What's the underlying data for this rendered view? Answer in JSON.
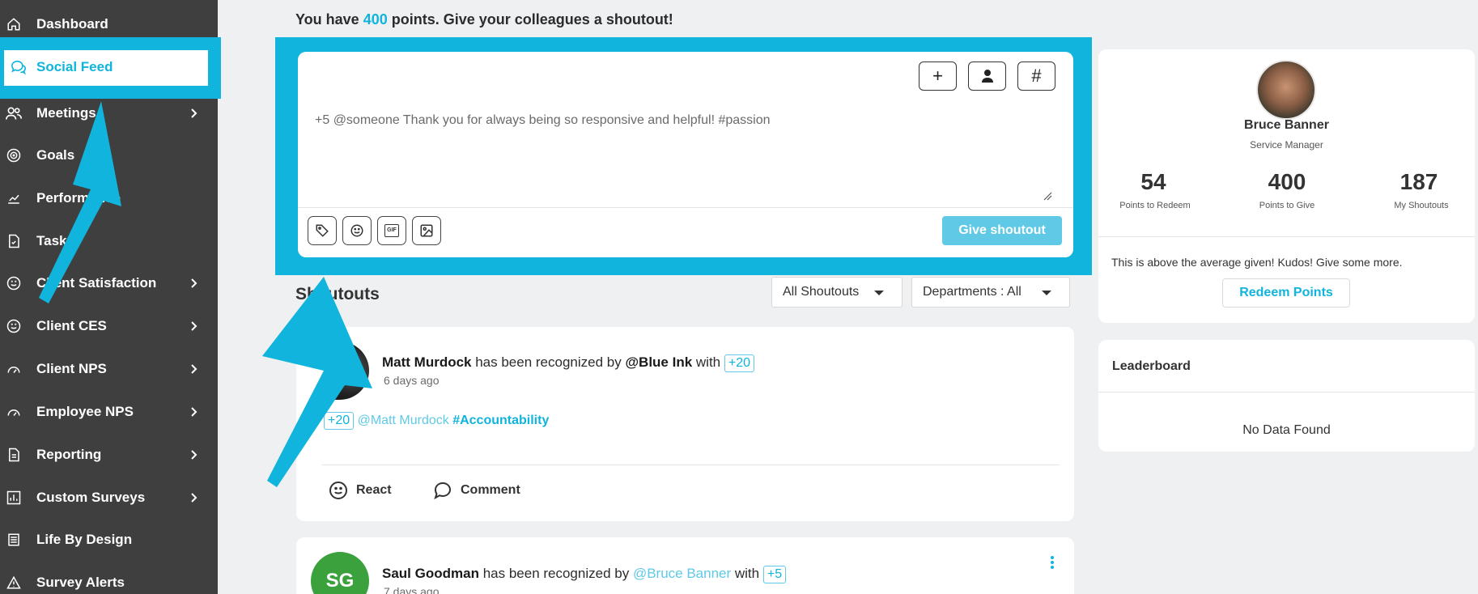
{
  "sidebar": {
    "items": [
      {
        "label": "Dashboard",
        "icon": "home-icon",
        "chevron": false
      },
      {
        "label": "Social Feed",
        "icon": "chat-icon",
        "chevron": false,
        "active": true
      },
      {
        "label": "Meetings",
        "icon": "people-icon",
        "chevron": true
      },
      {
        "label": "Goals",
        "icon": "target-icon",
        "chevron": false
      },
      {
        "label": "Performance",
        "icon": "chart-icon",
        "chevron": false
      },
      {
        "label": "Tasks",
        "icon": "task-icon",
        "chevron": false
      },
      {
        "label": "Client Satisfaction",
        "icon": "smile-icon",
        "chevron": true
      },
      {
        "label": "Client CES",
        "icon": "smile-icon",
        "chevron": true
      },
      {
        "label": "Client NPS",
        "icon": "gauge-icon",
        "chevron": true
      },
      {
        "label": "Employee NPS",
        "icon": "gauge-icon",
        "chevron": true
      },
      {
        "label": "Reporting",
        "icon": "report-icon",
        "chevron": true
      },
      {
        "label": "Custom Surveys",
        "icon": "bar-chart-icon",
        "chevron": true
      },
      {
        "label": "Life By Design",
        "icon": "list-icon",
        "chevron": false
      },
      {
        "label": "Survey Alerts",
        "icon": "warning-icon",
        "chevron": false
      }
    ]
  },
  "banner": {
    "prefix": "You have ",
    "points": "400",
    "suffix": " points. Give your colleagues a shoutout!"
  },
  "compose": {
    "tools": [
      "+",
      "person-icon",
      "#"
    ],
    "text": "+5 @someone Thank you for always being so responsive and helpful! #passion",
    "bottom_tools": [
      "tag-icon",
      "emoji-icon",
      "gif-icon",
      "image-icon"
    ],
    "gif_label": "GIF",
    "submit_label": "Give shoutout"
  },
  "feed": {
    "title": "Shoutouts",
    "filter_type": "All Shoutouts",
    "filter_dept": "Departments : All",
    "posts": [
      {
        "recipient": "Matt Murdock",
        "middle": " has been recognized by ",
        "giver": "@Blue Ink",
        "with": " with ",
        "points": "+20",
        "time": "6 days ago",
        "body_points": "+20",
        "body_mention": "@Matt Murdock",
        "body_tag": "#Accountability",
        "react_label": "React",
        "comment_label": "Comment"
      },
      {
        "initials": "SG",
        "recipient": "Saul Goodman",
        "middle": " has been recognized by ",
        "giver": "@Bruce Banner",
        "with": " with ",
        "points": "+5",
        "time": "7 days ago"
      }
    ]
  },
  "profile": {
    "name": "Bruce Banner",
    "role": "Service Manager",
    "stats": [
      {
        "value": "54",
        "label": "Points to Redeem"
      },
      {
        "value": "400",
        "label": "Points to Give"
      },
      {
        "value": "187",
        "label": "My Shoutouts"
      }
    ],
    "message": "This is above the average given! Kudos! Give some more.",
    "redeem_label": "Redeem Points"
  },
  "leaderboard": {
    "title": "Leaderboard",
    "empty": "No Data Found"
  },
  "colors": {
    "accent": "#10b4dc",
    "sidebar_bg": "#3f3f3f",
    "avatar_sg": "#3aa13d"
  }
}
